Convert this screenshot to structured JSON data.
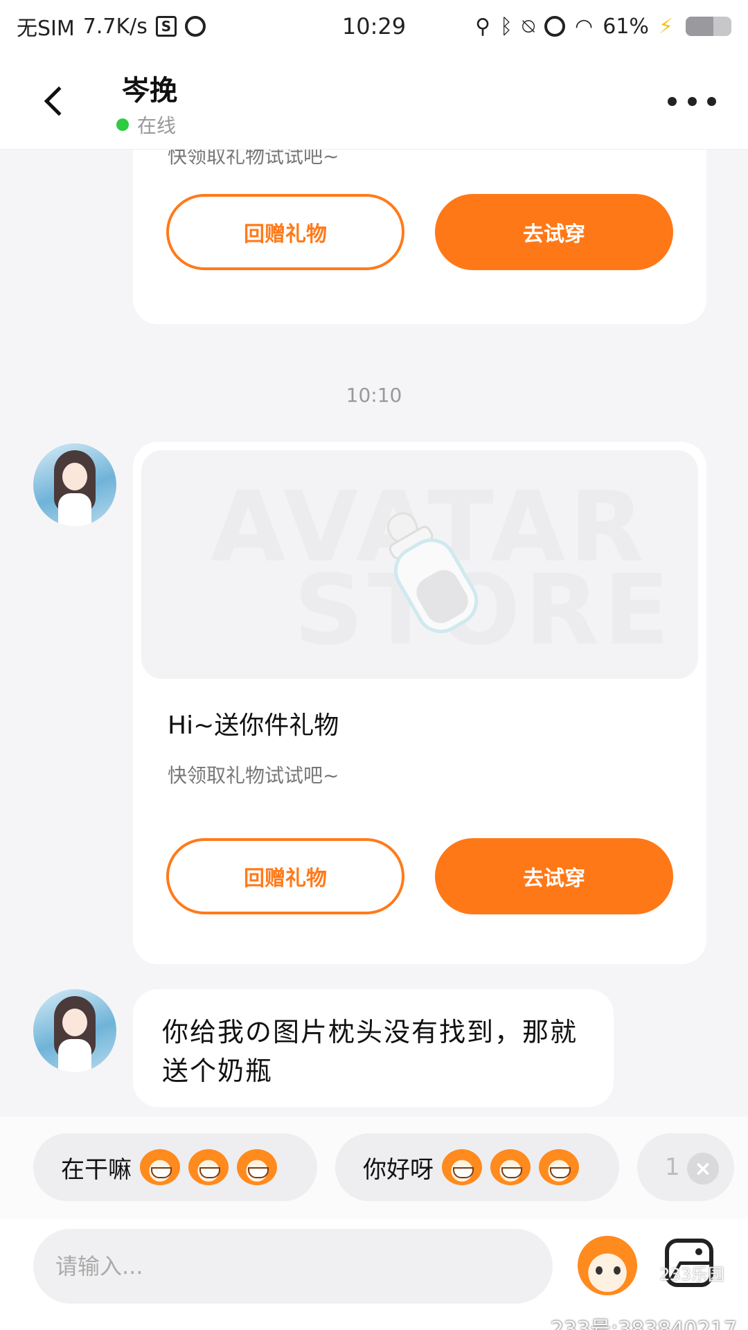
{
  "status_bar": {
    "carrier": "无SIM",
    "net_speed": "7.7K/s",
    "s_icon_text": "S",
    "time": "10:29",
    "battery": "61%",
    "battery_level": 0.61
  },
  "header": {
    "name": "岑挽",
    "status": "在线"
  },
  "messages": {
    "card1": {
      "subtitle": "快领取礼物试试吧~",
      "return_gift": "回赠礼物",
      "try_on": "去试穿"
    },
    "timestamp": "10:10",
    "card2": {
      "watermark_line1": "AVATAR",
      "watermark_line2": "STORE",
      "title": "Hi~送你件礼物",
      "subtitle": "快领取礼物试试吧~",
      "return_gift": "回赠礼物",
      "try_on": "去试穿"
    },
    "text_message": "你给我の图片枕头没有找到，那就送个奶瓶"
  },
  "quick_replies": [
    {
      "label": "在干嘛"
    },
    {
      "label": "你好呀"
    },
    {
      "label": "1"
    }
  ],
  "input": {
    "placeholder": "请输入..."
  },
  "watermark": {
    "logo": "233乐园",
    "id": "233号:383840217"
  },
  "colors": {
    "accent": "#ff7817",
    "online": "#2ecc40",
    "background": "#f5f5f7"
  },
  "icons": {
    "back": "chevron-left-icon",
    "more": "more-dots-icon",
    "close": "close-icon",
    "mascot": "mascot-emoji-icon",
    "image": "image-icon"
  }
}
